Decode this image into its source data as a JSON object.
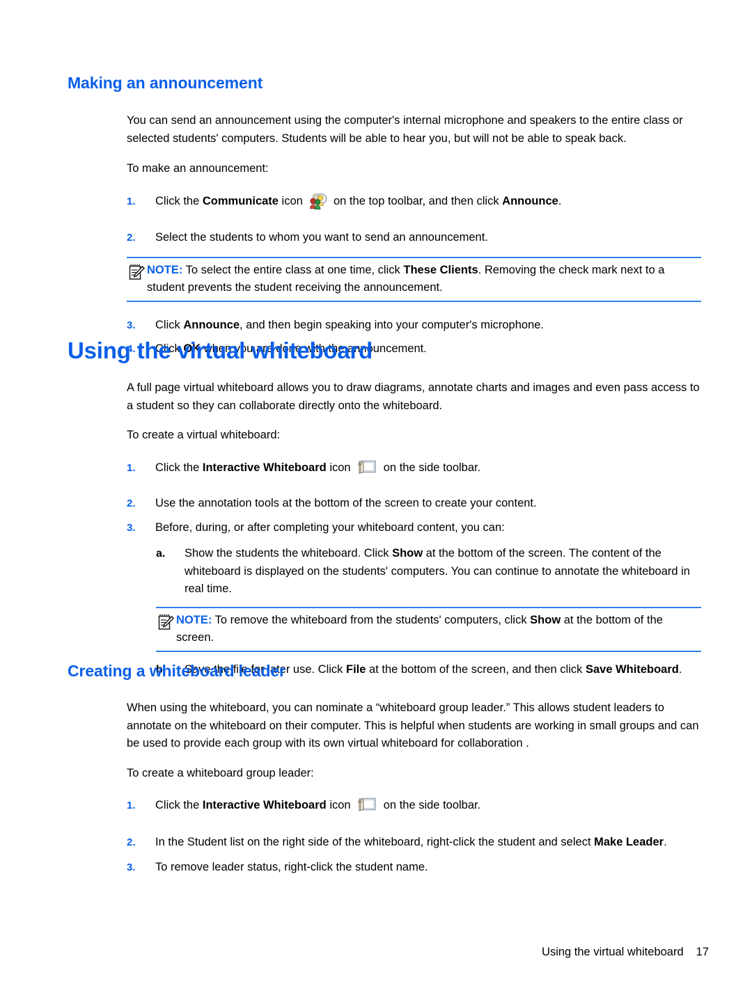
{
  "colors": {
    "heading_blue": "#0A5FE8",
    "rule_blue": "#2E7FE8",
    "body_black": "#000000"
  },
  "sections": [
    {
      "id": "making-an-announcement",
      "heading": "Making an announcement",
      "heading_level": "h2",
      "intro": "You can send an announcement using the computer's internal microphone and speakers to the entire class or selected students' computers. Students will be able to hear you, but will not be able to speak back.",
      "lead_in": "To make an announcement:",
      "steps": [
        {
          "marker": "1.",
          "text_pre": "Click the ",
          "bold1": "Communicate",
          "text_mid": " icon ",
          "icon": "communicate-icon",
          "text_post": " on the top toolbar, and then click ",
          "bold2": "Announce",
          "text_end": "."
        },
        {
          "marker": "2.",
          "text_full": "Select the students to whom you want to send an announcement."
        },
        {
          "marker": "3.",
          "text_pre": "Click ",
          "bold1": "Announce",
          "text_end": ", and then begin speaking into your computer's microphone."
        },
        {
          "marker": "4.",
          "text_pre": "Click ",
          "bold1": "OK",
          "text_end": " when you are done with the announcement."
        }
      ],
      "note": {
        "label": "NOTE:",
        "icon": "note-pad-pencil-icon",
        "text_pre": "   To select the entire class at one time, click ",
        "bold1": "These Clients",
        "text_end": ". Removing the check mark next to a student prevents the student receiving the announcement."
      }
    },
    {
      "id": "using-the-virtual-whiteboard",
      "heading": "Using the virtual whiteboard",
      "heading_level": "h1",
      "intro": "A full page virtual whiteboard allows you to draw diagrams, annotate charts and images and even pass access to a student so they can collaborate directly onto the whiteboard.",
      "lead_in": "To create a virtual whiteboard:",
      "steps": [
        {
          "marker": "1.",
          "text_pre": "Click the ",
          "bold1": "Interactive Whiteboard",
          "text_mid": " icon ",
          "icon": "interactive-whiteboard-icon",
          "text_post": " on the side toolbar."
        },
        {
          "marker": "2.",
          "text_full": "Use the annotation tools at the bottom of the screen to create your content."
        },
        {
          "marker": "3.",
          "text_full": "Before, during, or after completing your whiteboard content, you can:"
        }
      ],
      "substeps": [
        {
          "marker": "a.",
          "text_pre": "Show the students the whiteboard. Click ",
          "bold1": "Show",
          "text_end": " at the bottom of the screen. The content of the whiteboard is displayed on the students' computers. You can continue to annotate the whiteboard in real time."
        },
        {
          "marker": "b.",
          "text_pre": "Save the file for later use. Click ",
          "bold1": "File",
          "text_mid": " at the bottom of the screen, and then click ",
          "bold2": "Save Whiteboard",
          "text_end": "."
        }
      ],
      "note": {
        "label": "NOTE:",
        "icon": "note-pad-pencil-icon",
        "text_pre": "   To remove the whiteboard from the students' computers, click ",
        "bold1": "Show",
        "text_end": " at the bottom of the screen."
      }
    },
    {
      "id": "creating-a-whiteboard-leader",
      "heading": "Creating a whiteboard leader",
      "heading_level": "h2",
      "intro": "When using the whiteboard, you can nominate a “whiteboard group leader.” This allows student leaders to annotate on the whiteboard on their computer. This is helpful when students are working in small groups and can be used to provide each group with its own virtual whiteboard for collaboration .",
      "lead_in": "To create a whiteboard group leader:",
      "steps": [
        {
          "marker": "1.",
          "text_pre": "Click the ",
          "bold1": "Interactive Whiteboard",
          "text_mid": " icon ",
          "icon": "interactive-whiteboard-icon",
          "text_post": " on the side toolbar."
        },
        {
          "marker": "2.",
          "text_pre": "In the Student list on the right side of the whiteboard, right-click the student and select ",
          "bold1": "Make Leader",
          "text_end": "."
        },
        {
          "marker": "3.",
          "text_full": "To remove leader status, right-click the student name."
        }
      ]
    }
  ],
  "footer": {
    "chapter": "Using the virtual whiteboard",
    "page_number": "17"
  }
}
